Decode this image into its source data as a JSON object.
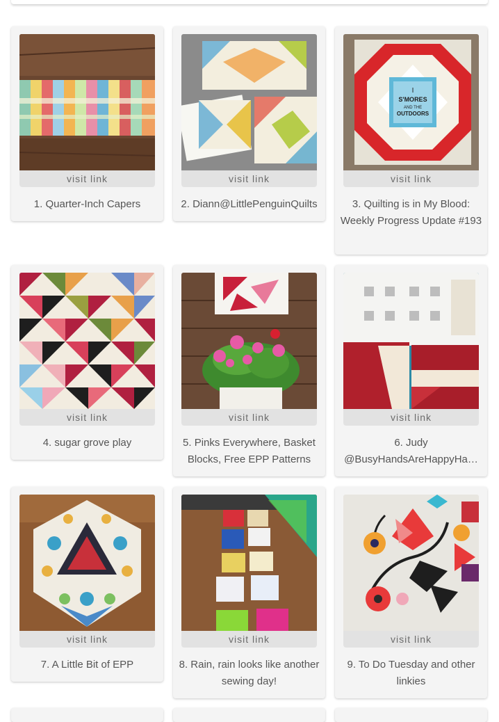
{
  "visit_label": "visit link",
  "links": [
    {
      "number": 1,
      "caption": "1. Quarter-Inch Capers"
    },
    {
      "number": 2,
      "caption": "2. Diann@LittlePenguinQuilts"
    },
    {
      "number": 3,
      "caption": "3. Quilting is in My Blood: Weekly Progress Update #193"
    },
    {
      "number": 4,
      "caption": "4. sugar grove play"
    },
    {
      "number": 5,
      "caption": "5. Pinks Everywhere, Basket Blocks, Free EPP Patterns"
    },
    {
      "number": 6,
      "caption_line1": "6. Judy",
      "caption_line2": "@BusyHandsAreHappyHa…"
    },
    {
      "number": 7,
      "caption": "7. A Little Bit of EPP"
    },
    {
      "number": 8,
      "caption": "8. Rain, rain looks like another sewing day!"
    },
    {
      "number": 9,
      "caption": "9. To Do Tuesday and other linkies"
    }
  ],
  "thumbnail_text": {
    "quilt_label_line1": "I",
    "quilt_label_line2": "S'MORES",
    "quilt_label_line3": "AND THE",
    "quilt_label_line4": "OUTDOORS"
  },
  "colors": {
    "card_bg": "#f4f4f4",
    "visit_bg": "#e2e2e2",
    "caption_text": "#555555"
  }
}
